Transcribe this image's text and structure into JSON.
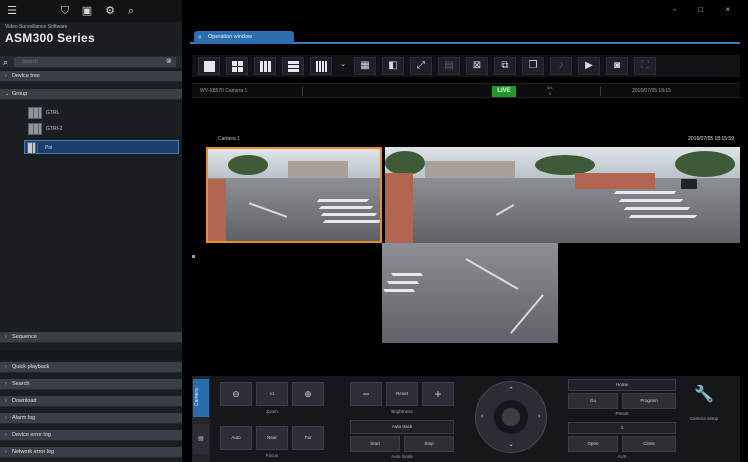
{
  "app": {
    "subtitle": "Video Surveillance Software",
    "brand": "ASM300 Series",
    "window_controls": [
      "-",
      "□",
      "×"
    ]
  },
  "search": {
    "placeholder": "Search",
    "value": ""
  },
  "sidebar": {
    "sections_top": [
      {
        "label": "Device tree"
      },
      {
        "label": "Group"
      }
    ],
    "tree_items": [
      {
        "label": "GTRL"
      },
      {
        "label": "GTRI-2"
      },
      {
        "label": "Pol",
        "selected": true
      }
    ],
    "sequence_label": "Sequence",
    "sections_bottom": [
      {
        "label": "Quick playback"
      },
      {
        "label": "Search"
      },
      {
        "label": "Download"
      },
      {
        "label": "Alarm log"
      },
      {
        "label": "Device error log"
      },
      {
        "label": "Network error log"
      }
    ]
  },
  "tab": {
    "label": "Operation window"
  },
  "status": {
    "camera_name": "WV-X8570 Camera 1",
    "live": "LIVE",
    "mid_top": "4/4",
    "mid_bottom": "8",
    "date": "2016/07/05 18:15"
  },
  "video": {
    "camera_label": "Camera 1",
    "timestamp": "2016/07/05 18:15:59"
  },
  "controls": {
    "camera_tab": "Camera",
    "zoom_label": "Zoom",
    "zoom_x1": "x1",
    "brightness_label": "Brightness",
    "brightness_reset": "Reset",
    "auto_mode_label": "Auto mode",
    "auto_mode_select": "Auto track",
    "start_label": "Start",
    "stop_label": "Stop",
    "focus_label": "Focus",
    "focus_auto": "Auto",
    "focus_near": "Near",
    "focus_far": "Far",
    "preset_label": "Preset",
    "preset_home": "Home",
    "preset_go": "Go",
    "preset_program": "Program",
    "aux_label": "AUX",
    "aux_open": "Open",
    "aux_close": "Close",
    "aux_number": "1",
    "camera_setup_label": "Camera setup"
  }
}
